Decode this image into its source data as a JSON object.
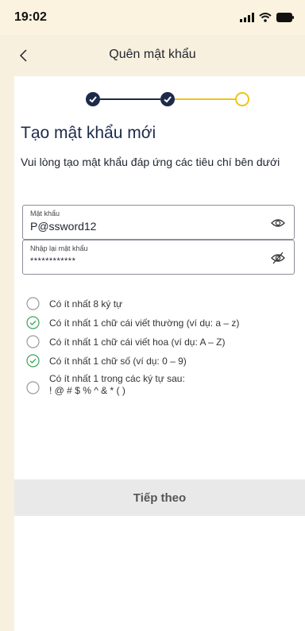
{
  "status_bar": {
    "time": "19:02"
  },
  "nav": {
    "title": "Quên mật khẩu"
  },
  "stepper": {
    "total_steps": 3,
    "current_step": 3
  },
  "form": {
    "title": "Tạo mật khẩu mới",
    "description": "Vui lòng tạo mật khẩu đáp ứng các tiêu chí bên dưới",
    "password": {
      "label": "Mật khẩu",
      "value": "P@ssword12"
    },
    "confirm_password": {
      "label": "Nhập lại mật khẩu",
      "value": "************"
    }
  },
  "criteria": [
    {
      "text": "Có ít nhất 8 ký tự",
      "met": false
    },
    {
      "text": "Có ít nhất 1 chữ cái viết thường (ví dụ: a – z)",
      "met": true
    },
    {
      "text": "Có ít nhất 1 chữ cái viết hoa (ví dụ: A – Z)",
      "met": false
    },
    {
      "text": "Có ít nhất 1 chữ số (ví dụ: 0 – 9)",
      "met": true
    },
    {
      "text": "Có ít nhất 1 trong các ký tự sau:",
      "text2": "! @ # $ % ^ & * ( )",
      "met": false
    }
  ],
  "actions": {
    "continue_label": "Tiếp theo"
  },
  "colors": {
    "background": "#f8f0de",
    "primary": "#1d2a4a",
    "accent": "#f0c419",
    "success": "#3aa45b",
    "unmet": "#9a9a9a"
  }
}
